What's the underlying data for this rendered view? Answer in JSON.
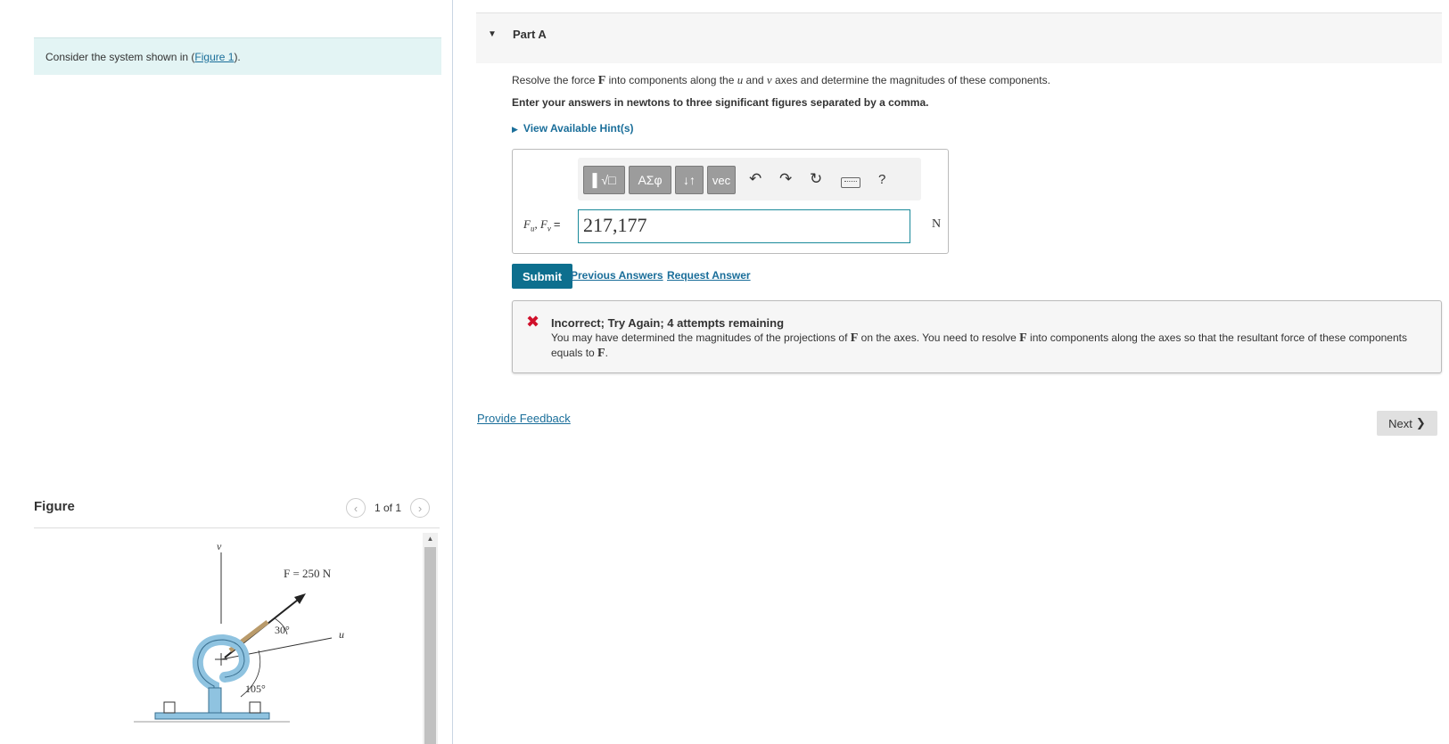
{
  "intro": {
    "prefix": "Consider the system shown in (",
    "figure_link": "Figure 1",
    "suffix": ")."
  },
  "figure": {
    "title": "Figure",
    "pager": "1 of 1",
    "prev_icon": "chevron-left-icon",
    "next_icon": "chevron-right-icon",
    "labels": {
      "v_axis": "v",
      "u_axis": "u",
      "force": "F = 250 N",
      "angle1": "30°",
      "angle2": "105°"
    }
  },
  "part": {
    "label": "Part A",
    "prompt_pre": "Resolve the force ",
    "prompt_F": "F",
    "prompt_mid": " into components along the ",
    "prompt_u": "u",
    "prompt_and": " and ",
    "prompt_v": "v",
    "prompt_post": " axes and determine the magnitudes of these components.",
    "instructions": "Enter your answers in newtons to three significant figures separated by a comma.",
    "hint_link": "View Available Hint(s)"
  },
  "answer": {
    "toolbar": {
      "templates": "▌√□",
      "greek": "AΣφ",
      "arrows": "↓↑",
      "vec": "vec",
      "help": "?"
    },
    "label_a": "F",
    "label_a_sub": "u",
    "label_sep": ", ",
    "label_b": "F",
    "label_b_sub": "v",
    "equals": "=",
    "value": "217,177",
    "unit": "N"
  },
  "actions": {
    "submit": "Submit",
    "previous_answers": "Previous Answers",
    "request_answer": "Request Answer"
  },
  "feedback": {
    "status": "Incorrect; Try Again; 4 attempts remaining",
    "msg_pre": "You may have determined the magnitudes of the projections of ",
    "msg_F1": "F",
    "msg_mid": " on the axes. You need to resolve ",
    "msg_F2": "F",
    "msg_mid2": " into components along the axes so that the resultant force of these components equals to ",
    "msg_F3": "F",
    "msg_end": "."
  },
  "footer": {
    "provide_feedback": "Provide Feedback",
    "next": "Next"
  },
  "colors": {
    "accent": "#0d6f8e",
    "link": "#1a6e9a",
    "error": "#d0102b",
    "intro_bg": "#e3f4f4",
    "hook": "#8fc3e0"
  }
}
